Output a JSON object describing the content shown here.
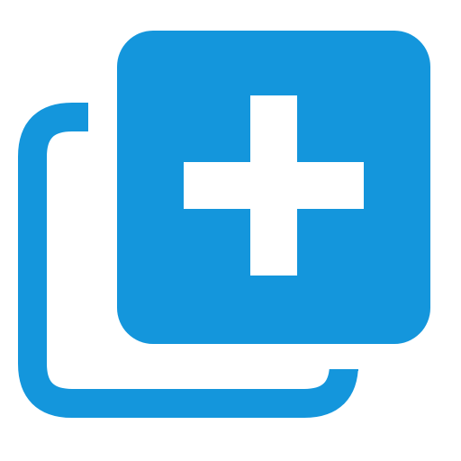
{
  "icon": {
    "name": "add-copy-icon",
    "accent_color": "#1496dc",
    "symbol_color": "#ffffff"
  }
}
